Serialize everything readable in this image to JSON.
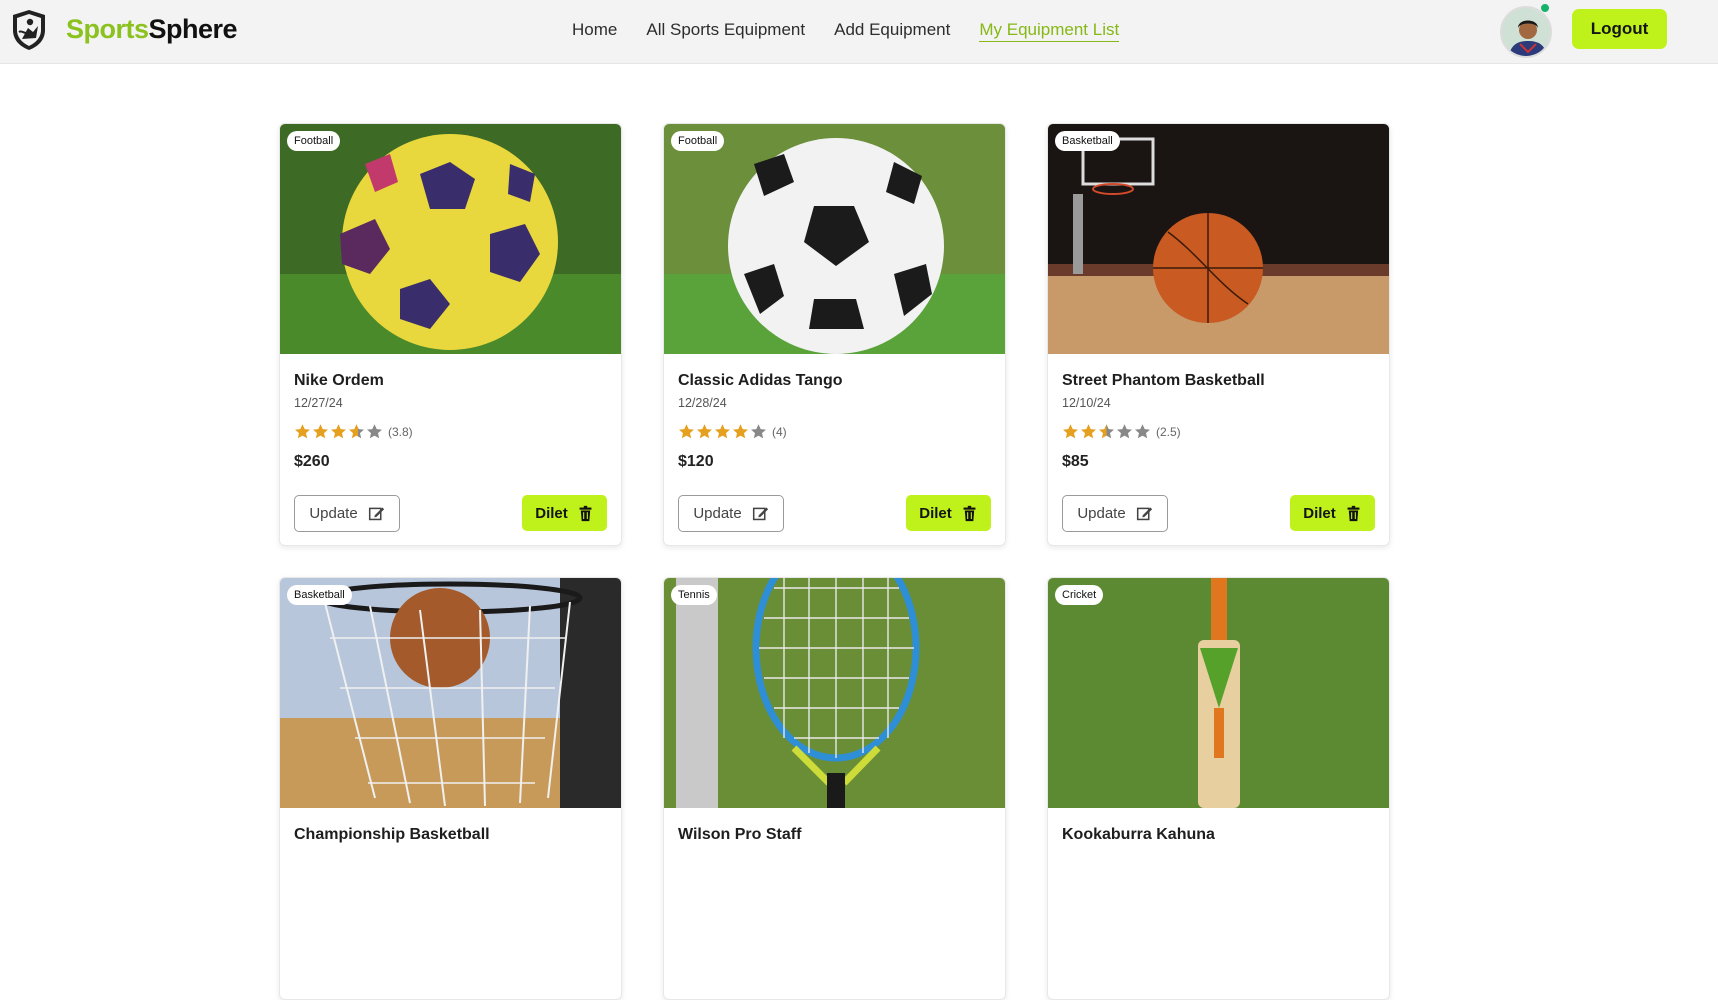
{
  "brand": {
    "part1": "Sports",
    "part2": "Sphere"
  },
  "nav": {
    "links": [
      {
        "label": "Home",
        "active": false
      },
      {
        "label": "All Sports Equipment",
        "active": false
      },
      {
        "label": "Add Equipment",
        "active": false
      },
      {
        "label": "My Equipment List",
        "active": true
      }
    ],
    "logout_label": "Logout"
  },
  "colors": {
    "accent": "#bff21b",
    "brand_green": "#8cc21f",
    "star": "#e4a01e",
    "star_empty": "#888888",
    "online": "#18b26b"
  },
  "card_buttons": {
    "update_label": "Update",
    "delete_label": "Dilet",
    "update_icon": "edit-icon",
    "delete_icon": "trash-icon"
  },
  "cards": [
    {
      "category": "Football",
      "title": "Nike Ordem",
      "date": "12/27/24",
      "rating": 3.8,
      "rating_text": "(3.8)",
      "price": "$260",
      "image": "yellow-football"
    },
    {
      "category": "Football",
      "title": "Classic Adidas Tango",
      "date": "12/28/24",
      "rating": 4,
      "rating_text": "(4)",
      "price": "$120",
      "image": "white-football"
    },
    {
      "category": "Basketball",
      "title": "Street Phantom Basketball",
      "date": "12/10/24",
      "rating": 2.5,
      "rating_text": "(2.5)",
      "price": "$85",
      "image": "basketball-court"
    },
    {
      "category": "Basketball",
      "title": "Championship Basketball",
      "image": "basketball-hoop"
    },
    {
      "category": "Tennis",
      "title": "Wilson Pro Staff",
      "image": "tennis-racket"
    },
    {
      "category": "Cricket",
      "title": "Kookaburra Kahuna",
      "image": "cricket-bat"
    }
  ]
}
